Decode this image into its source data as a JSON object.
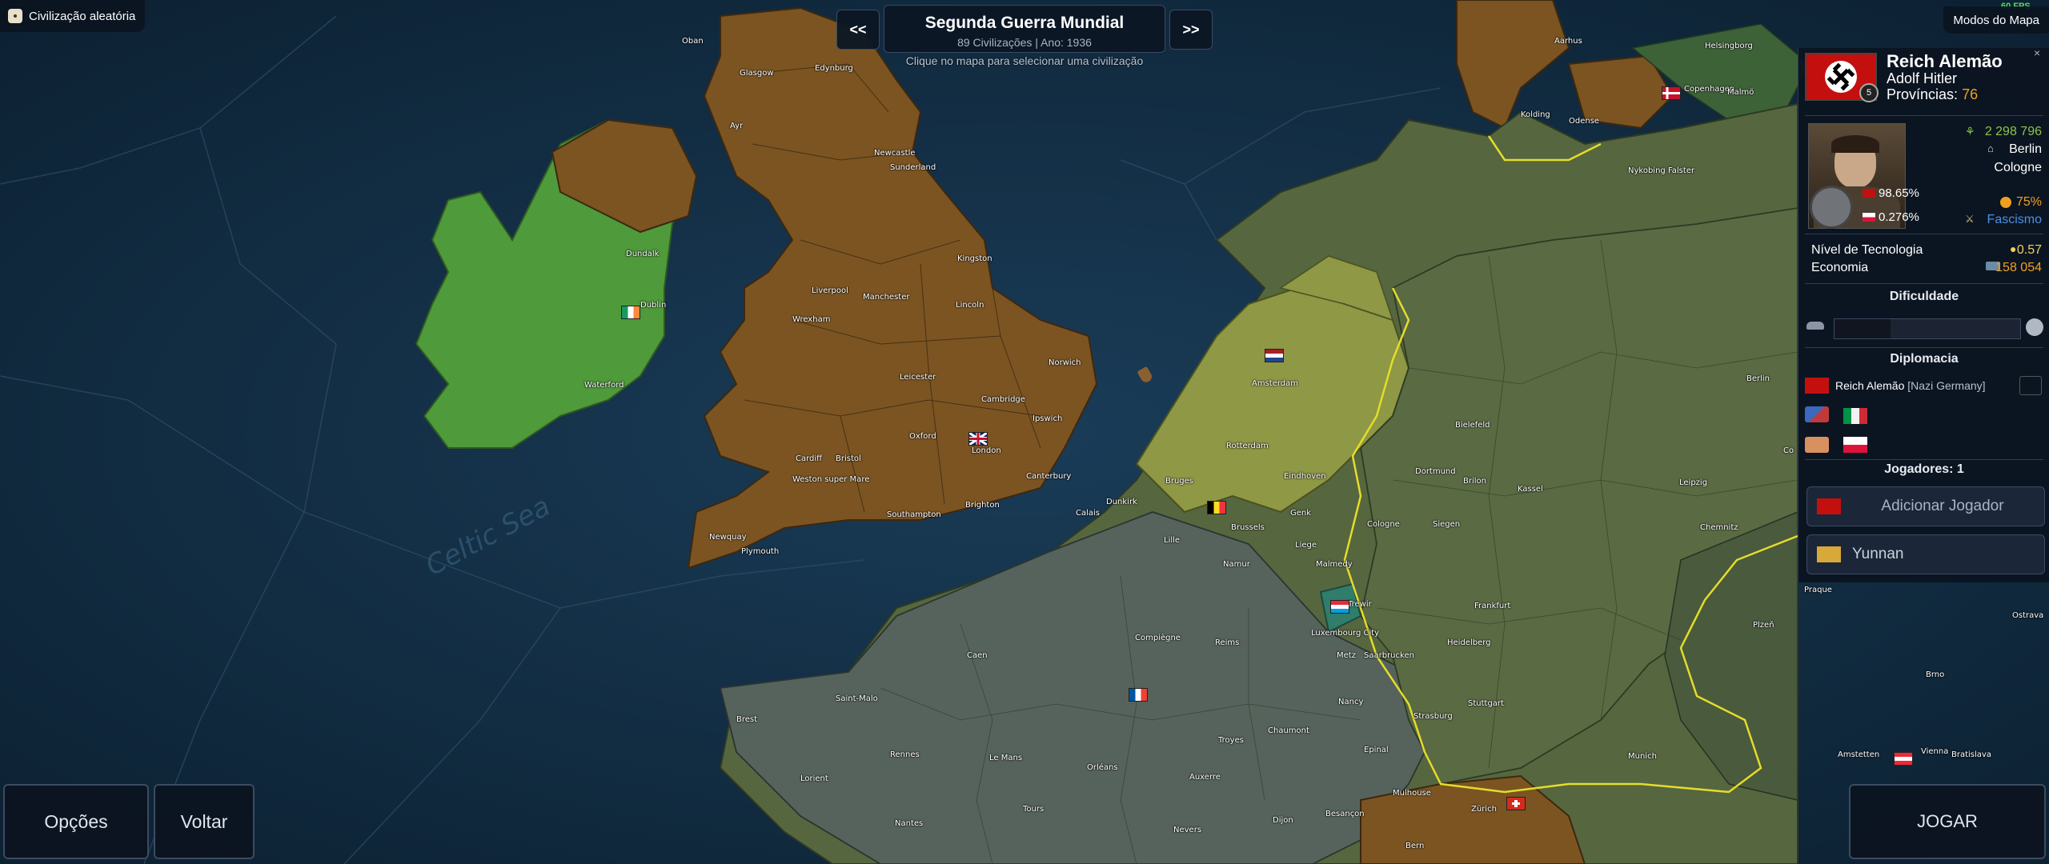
{
  "top_left": {
    "random_civ_label": "Civilização aleatória"
  },
  "scenario": {
    "prev": "<<",
    "next": ">>",
    "title": "Segunda Guerra Mundial",
    "subtitle": "89 Civilizações | Ano: 1936",
    "hint": "Clique no mapa para selecionar uma civilização"
  },
  "top_right": {
    "fps": "60 FPS",
    "map_modes": "Modos do Mapa"
  },
  "civ": {
    "name": "Reich Alemão",
    "leader": "Adolf Hitler",
    "provinces_label": "Províncias:",
    "provinces": "76",
    "rank": "5",
    "population": "2 298 796",
    "capital": "Berlin",
    "second_city": "Cologne",
    "stat1": "98.65%",
    "stat2": "0.276%",
    "happiness": "75%",
    "ideology": "Fascismo",
    "tech_label": "Nível de Tecnologia",
    "tech_value": "0.57",
    "economy_label": "Economia",
    "economy_value": "158 054",
    "colors": {
      "happiness": "#f0a020",
      "ideology": "#4a90e2",
      "population": "#8bc34a",
      "economy": "#f0a020",
      "tech": "#f0d060"
    }
  },
  "difficulty": {
    "label": "Dificuldade",
    "level": 0.3
  },
  "diplomacy": {
    "label": "Diplomacia",
    "entry_name": "Reich Alemão",
    "entry_tag": "[Nazi Germany]"
  },
  "players": {
    "label": "Jogadores: 1",
    "add_player": "Adicionar Jogador",
    "player_civ": "Yunnan"
  },
  "bottom": {
    "options": "Opções",
    "back": "Voltar",
    "play": "JOGAR"
  },
  "map_labels": {
    "sea": "Celtic Sea",
    "cities": [
      "Oban",
      "Glasgow",
      "Edynburg",
      "Ayr",
      "Newcastle",
      "Sunderland",
      "Dundalk",
      "Dublin",
      "Waterford",
      "Liverpool",
      "Manchester",
      "Kingston",
      "Lincoln",
      "Wrexham",
      "Norwich",
      "Leicester",
      "Cambridge",
      "Oxford",
      "London",
      "Ipswich",
      "Cardiff",
      "Bristol",
      "Weston super Mare",
      "Canterbury",
      "Brighton",
      "Southampton",
      "Newquay",
      "Plymouth",
      "Amsterdam",
      "Rotterdam",
      "Eindhoven",
      "Bruges",
      "Dunkirk",
      "Calais",
      "Brussels",
      "Genk",
      "Lille",
      "Liege",
      "Namur",
      "Malmedy",
      "Trewir",
      "Luxembourg City",
      "Compiègne",
      "Reims",
      "Caen",
      "Metz",
      "Saarbrucken",
      "Saint-Malo",
      "Brest",
      "Rennes",
      "Le Mans",
      "Orléans",
      "Troyes",
      "Chaumont",
      "Nancy",
      "Strasburg",
      "Lorient",
      "Auxerre",
      "Epinal",
      "Mulhouse",
      "Tours",
      "Nevers",
      "Dijon",
      "Besançon",
      "Nantes",
      "Zürich",
      "Bern",
      "Aarhus",
      "Kolding",
      "Odense",
      "Helsingborg",
      "Copenhagen",
      "Malmö",
      "Nykobing Falster",
      "Bielefeld",
      "Dortmund",
      "Brilon",
      "Kassel",
      "Cologne",
      "Siegen",
      "Frankfurt",
      "Heidelberg",
      "Stuttgart",
      "Munich",
      "Leipzig",
      "Chemnitz",
      "Berlin",
      "Praque",
      "Plzeň",
      "Brno",
      "Amstetten",
      "Vienna",
      "Bratislava",
      "Ostrava",
      "Co"
    ]
  }
}
